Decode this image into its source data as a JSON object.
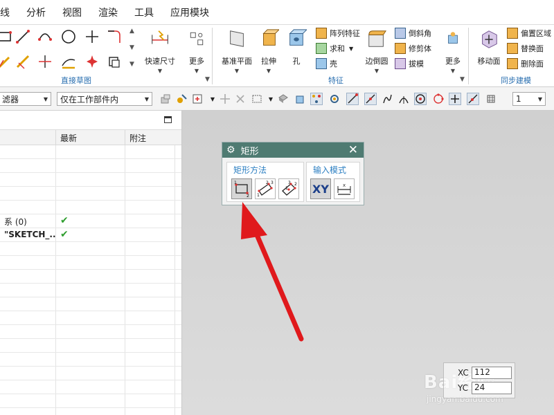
{
  "menubar": {
    "items": [
      "线",
      "分析",
      "视图",
      "渲染",
      "工具",
      "应用模块"
    ]
  },
  "ribbon": {
    "groups": {
      "direct_sketch": "直接草图",
      "feature": "特征",
      "sync_modeling": "同步建模"
    },
    "buttons": {
      "quick_dimension": "快速尺寸",
      "more1": "更多",
      "datum_plane": "基准平面",
      "extrude": "拉伸",
      "hole": "孔",
      "pattern_feature": "阵列特征",
      "unite": "求和",
      "shell": "壳",
      "edge_blend": "边倒圆",
      "chamfer": "倒斜角",
      "trim_body": "修剪体",
      "draft": "拔模",
      "more2": "更多",
      "move_face": "移动面",
      "offset_region": "偏置区域",
      "replace_face": "替换面",
      "delete_face": "删除面"
    }
  },
  "toolbar": {
    "filter_value": "滤器",
    "scope_value": "仅在工作部件内",
    "count_value": "1"
  },
  "navigator": {
    "columns": [
      "",
      "最新",
      "附注"
    ],
    "rows": [
      {
        "name": "",
        "latest": ""
      },
      {
        "name": "",
        "latest": ""
      },
      {
        "name": "",
        "latest": ""
      },
      {
        "name": "",
        "latest": ""
      },
      {
        "name": "",
        "latest": ""
      },
      {
        "name": "系 (0)",
        "latest": "✔"
      },
      {
        "name": "\"SKETCH_...",
        "latest": "✔"
      },
      {
        "name": "",
        "latest": ""
      },
      {
        "name": "",
        "latest": ""
      },
      {
        "name": "",
        "latest": ""
      },
      {
        "name": "",
        "latest": ""
      },
      {
        "name": "",
        "latest": ""
      },
      {
        "name": "",
        "latest": ""
      },
      {
        "name": "",
        "latest": ""
      },
      {
        "name": "",
        "latest": ""
      },
      {
        "name": "",
        "latest": ""
      },
      {
        "name": "",
        "latest": ""
      },
      {
        "name": "",
        "latest": ""
      },
      {
        "name": "",
        "latest": ""
      },
      {
        "name": "",
        "latest": ""
      }
    ]
  },
  "dialog": {
    "title": "矩形",
    "method_label": "矩形方法",
    "input_label": "输入模式",
    "xy_label": "XY"
  },
  "coords": {
    "xc_label": "XC",
    "xc_value": "112",
    "yc_label": "YC",
    "yc_value": "24"
  },
  "watermark": {
    "text": "Bai经验",
    "url": "jingyan.baidu.com"
  },
  "colors": {
    "dialog_title_bg": "#4f7b72",
    "group_label": "#2a6fb0",
    "check_green": "#2f9e2f",
    "arrow_red": "#e0191c"
  }
}
